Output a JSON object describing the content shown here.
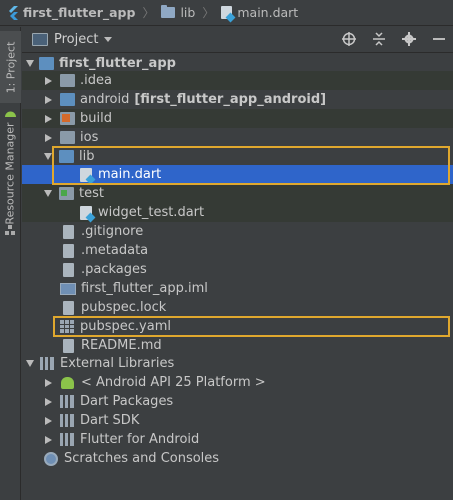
{
  "breadcrumb": {
    "items": [
      "first_flutter_app",
      "lib",
      "main.dart"
    ]
  },
  "left_strip": {
    "project_tab": "1: Project",
    "resource_tab": "Resource Manager"
  },
  "panel": {
    "title": "Project",
    "tools": [
      "target-icon",
      "collapse-icon",
      "gear-icon",
      "minimize-icon"
    ]
  },
  "tree": [
    {
      "label": "first_flutter_app",
      "bold": true
    },
    {
      "label": ".idea"
    },
    {
      "label": "android",
      "suffix": "[first_flutter_app_android]"
    },
    {
      "label": "build"
    },
    {
      "label": "ios"
    },
    {
      "label": "lib"
    },
    {
      "label": "main.dart"
    },
    {
      "label": "test"
    },
    {
      "label": "widget_test.dart"
    },
    {
      "label": ".gitignore"
    },
    {
      "label": ".metadata"
    },
    {
      "label": ".packages"
    },
    {
      "label": "first_flutter_app.iml"
    },
    {
      "label": "pubspec.lock"
    },
    {
      "label": "pubspec.yaml"
    },
    {
      "label": "README.md"
    },
    {
      "label": "External Libraries"
    },
    {
      "label": "< Android API 25 Platform >"
    },
    {
      "label": "Dart Packages"
    },
    {
      "label": "Dart SDK"
    },
    {
      "label": "Flutter for Android"
    },
    {
      "label": "Scratches and Consoles"
    }
  ],
  "colors": {
    "selection": "#2f65ca",
    "highlight_box": "#e0a82e",
    "background": "#3c3f41"
  }
}
